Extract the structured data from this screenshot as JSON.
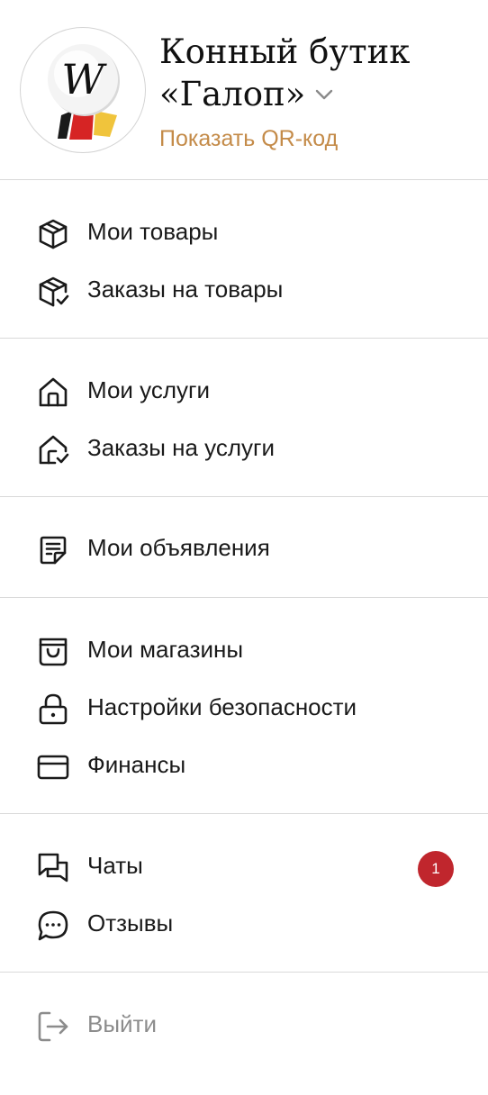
{
  "header": {
    "shop_name_line1": "Конный бутик",
    "shop_name_line2": "«Галоп»",
    "qr_link": "Показать QR-код",
    "logo_letter": "W"
  },
  "menu": {
    "goods": {
      "my_goods": "Мои товары",
      "goods_orders": "Заказы на товары"
    },
    "services": {
      "my_services": "Мои услуги",
      "service_orders": "Заказы на услуги"
    },
    "ads": {
      "my_ads": "Мои объявления"
    },
    "account": {
      "my_shops": "Мои магазины",
      "security": "Настройки безопасности",
      "finance": "Финансы"
    },
    "communication": {
      "chats": "Чаты",
      "chats_badge": "1",
      "reviews": "Отзывы"
    },
    "logout": "Выйти"
  },
  "icons": {
    "my_goods": "box-icon",
    "goods_orders": "box-check-icon",
    "my_services": "home-icon",
    "service_orders": "home-check-icon",
    "my_ads": "document-icon",
    "my_shops": "shopping-bag-icon",
    "security": "lock-icon",
    "finance": "credit-card-icon",
    "chats": "chat-bubbles-icon",
    "reviews": "comment-dots-icon",
    "logout": "logout-icon"
  },
  "colors": {
    "accent": "#c48b49",
    "badge": "#c0262d",
    "divider": "#d9d9d9",
    "text": "#1a1a1a",
    "muted": "#8c8c8c"
  }
}
